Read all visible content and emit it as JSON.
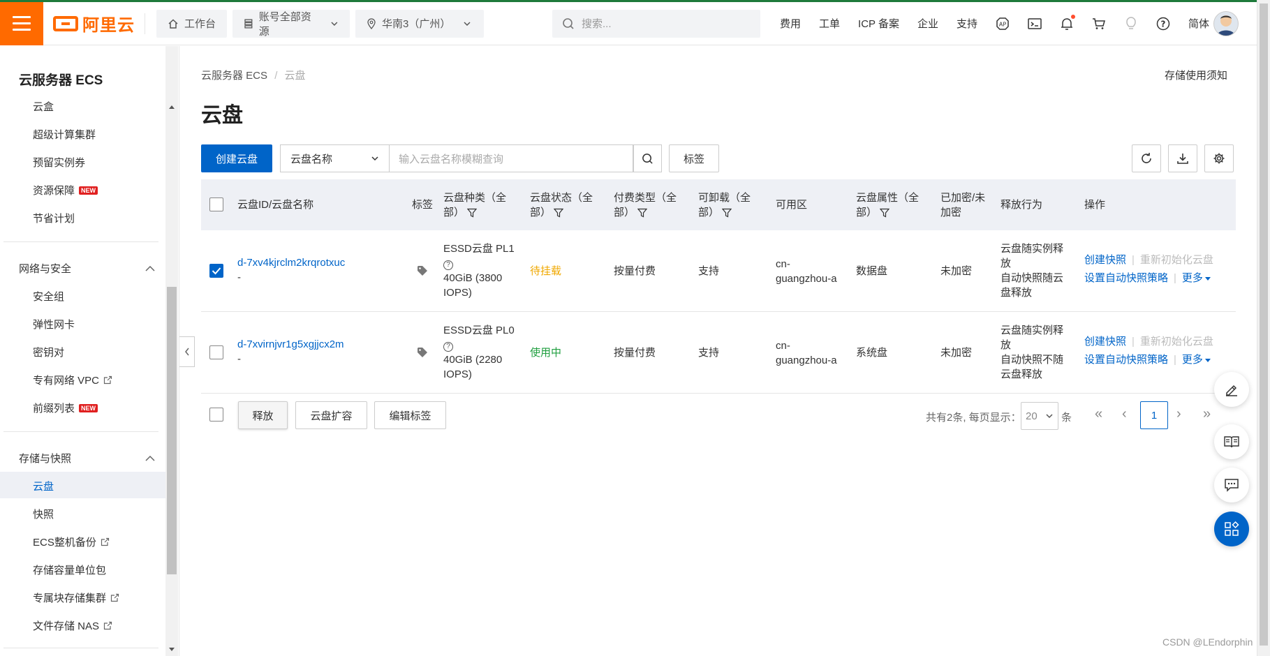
{
  "colors": {
    "brand": "#ff6a00",
    "primary": "#0064c8",
    "pending": "#f0a800",
    "in_use": "#1e9e3e"
  },
  "topbar": {
    "logo": "阿里云",
    "workbench": "工作台",
    "account": "账号全部资源",
    "region": "华南3（广州）",
    "search_placeholder": "搜索...",
    "links": [
      "费用",
      "工单",
      "ICP 备案",
      "企业",
      "支持"
    ],
    "lang": "简体"
  },
  "sidebar": {
    "title": "云服务器 ECS",
    "items_top": [
      "云盒",
      "超级计算集群",
      "预留实例券",
      "资源保障",
      "节省计划"
    ],
    "new_badge": "NEW",
    "group_network": "网络与安全",
    "items_network": [
      "安全组",
      "弹性网卡",
      "密钥对",
      "专有网络 VPC",
      "前缀列表"
    ],
    "group_storage": "存储与快照",
    "items_storage": [
      "云盘",
      "快照",
      "ECS整机备份",
      "存储容量单位包",
      "专属块存储集群",
      "文件存储 NAS"
    ]
  },
  "main": {
    "breadcrumb_root": "云服务器 ECS",
    "breadcrumb_sep": "/",
    "breadcrumb_current": "云盘",
    "notice": "存储使用须知",
    "title": "云盘",
    "create_button": "创建云盘",
    "filter_field": "云盘名称",
    "filter_placeholder": "输入云盘名称模糊查询",
    "tag_button": "标签"
  },
  "table": {
    "headers": {
      "id": "云盘ID/云盘名称",
      "tag": "标签",
      "type_l1": "云盘种类（全",
      "type_l2": "部）",
      "status_l1": "云盘状态（全",
      "status_l2": "部）",
      "billing_l1": "付费类型（全",
      "billing_l2": "部）",
      "detach_l1": "可卸载（全",
      "detach_l2": "部）",
      "zone": "可用区",
      "attr_l1": "云盘属性（全",
      "attr_l2": "部）",
      "enc_l1": "已加密/未",
      "enc_l2": "加密",
      "release": "释放行为",
      "ops": "操作"
    },
    "rows": [
      {
        "id": "d-7xv4kjrclm2krqrotxuc",
        "name": "-",
        "type_l1": "ESSD云盘  PL1",
        "type_l3": "40GiB (3800",
        "type_l4": "IOPS)",
        "status": "待挂载",
        "billing": "按量付费",
        "detachable": "支持",
        "zone_l1": "cn-",
        "zone_l2": "guangzhou-a",
        "attr": "数据盘",
        "encrypted": "未加密",
        "release_l1": "云盘随实例释",
        "release_l2": "放",
        "release_l3": "自动快照随云",
        "release_l4": "盘释放",
        "op_snapshot": "创建快照",
        "op_reinit": "重新初始化云盘",
        "op_policy": "设置自动快照策略",
        "op_more": "更多"
      },
      {
        "id": "d-7xvirnjvr1g5xgjjcx2m",
        "name": "-",
        "type_l1": "ESSD云盘  PL0",
        "type_l3": "40GiB (2280",
        "type_l4": "IOPS)",
        "status": "使用中",
        "billing": "按量付费",
        "detachable": "支持",
        "zone_l1": "cn-",
        "zone_l2": "guangzhou-a",
        "attr": "系统盘",
        "encrypted": "未加密",
        "release_l1": "云盘随实例释",
        "release_l2": "放",
        "release_l3": "自动快照不随",
        "release_l4": "云盘释放",
        "op_snapshot": "创建快照",
        "op_reinit": "重新初始化云盘",
        "op_policy": "设置自动快照策略",
        "op_more": "更多"
      }
    ]
  },
  "footer_actions": {
    "release": "释放",
    "expand": "云盘扩容",
    "edit_tags": "编辑标签"
  },
  "pagination": {
    "total_text": "共有2条, 每页显示：",
    "page_size": "20",
    "unit": "条",
    "current_page": "1"
  },
  "watermark": "CSDN @LEndorphin"
}
